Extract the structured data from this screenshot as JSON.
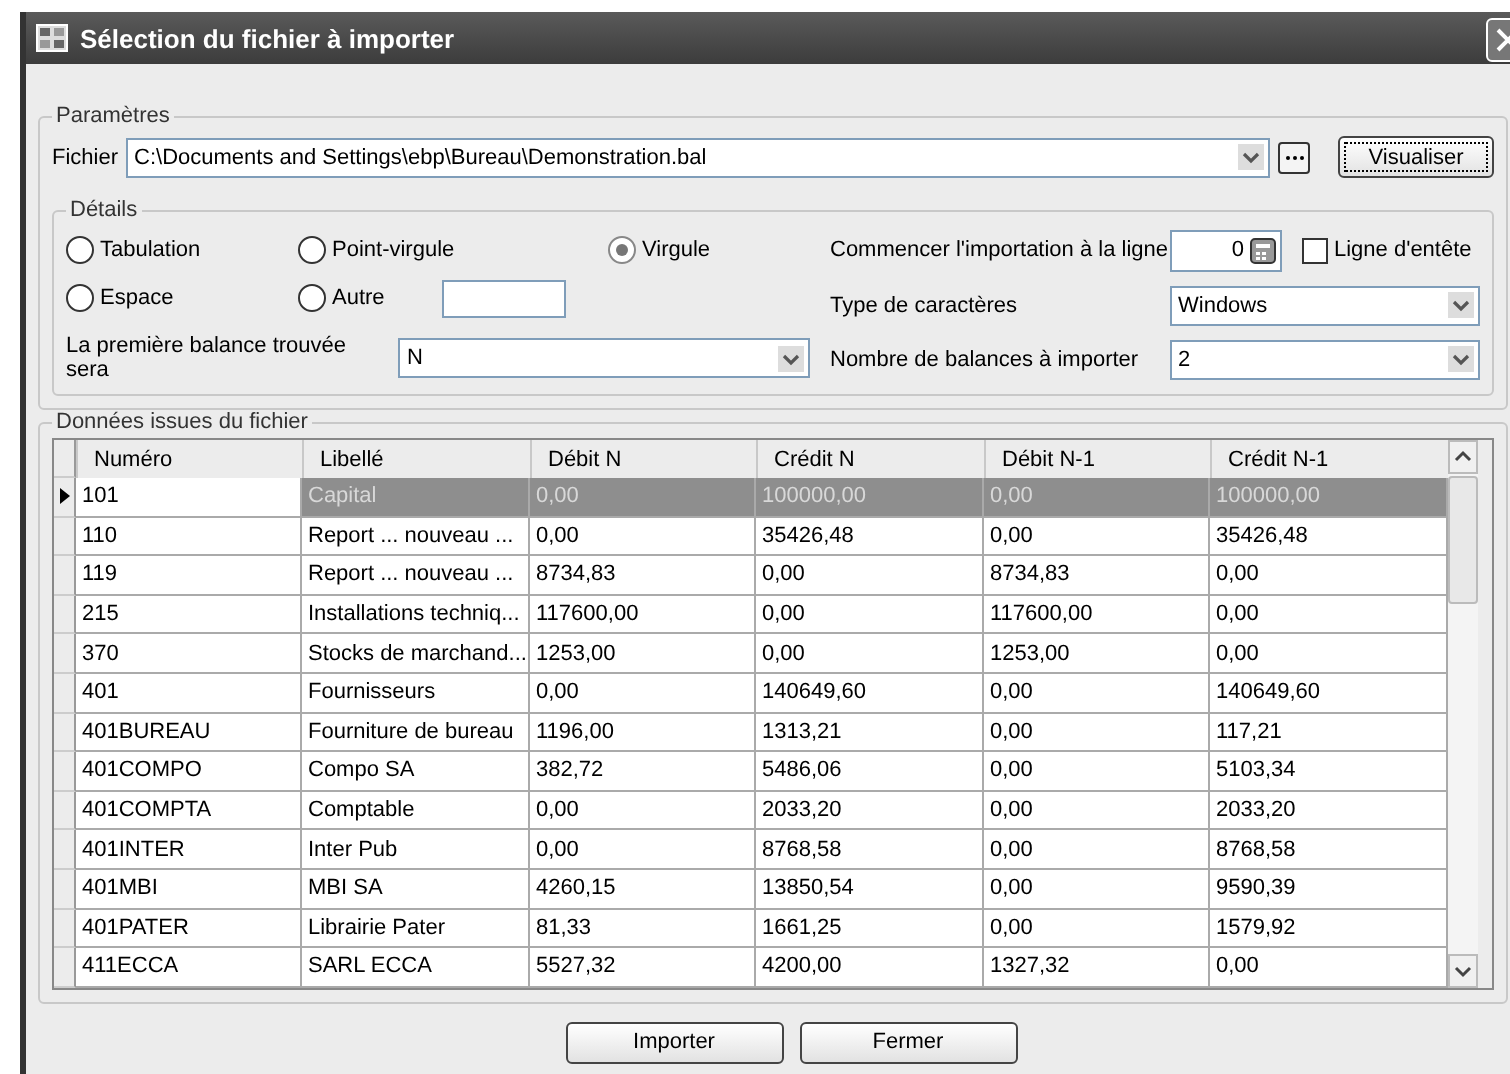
{
  "window": {
    "title": "Sélection du fichier à importer"
  },
  "parametres": {
    "legend": "Paramètres",
    "file_label": "Fichier",
    "file_value": "C:\\Documents and Settings\\ebp\\Bureau\\Demonstration.bal",
    "preview_button": "Visualiser"
  },
  "details": {
    "legend": "Détails",
    "separators": [
      {
        "label": "Tabulation",
        "selected": false
      },
      {
        "label": "Point-virgule",
        "selected": false
      },
      {
        "label": "Virgule",
        "selected": true
      },
      {
        "label": "Espace",
        "selected": false
      },
      {
        "label": "Autre",
        "selected": false
      }
    ],
    "first_balance_label": "La première balance trouvée sera",
    "first_balance_value": "N",
    "start_line_label": "Commencer l'importation à la ligne",
    "start_line_value": "0",
    "header_line": {
      "label": "Ligne d'entête",
      "checked": false
    },
    "charset_label": "Type de caractères",
    "charset_value": "Windows",
    "count_label": "Nombre de balances à importer",
    "count_value": "2"
  },
  "data": {
    "legend": "Données issues du fichier",
    "columns": [
      "Numéro",
      "Libellé",
      "Débit N",
      "Crédit N",
      "Débit N-1",
      "Crédit N-1"
    ],
    "rows": [
      {
        "selected": true,
        "cells": [
          "101",
          "Capital",
          "0,00",
          "100000,00",
          "0,00",
          "100000,00"
        ]
      },
      {
        "selected": false,
        "cells": [
          "110",
          "Report ... nouveau ...",
          "0,00",
          "35426,48",
          "0,00",
          "35426,48"
        ]
      },
      {
        "selected": false,
        "cells": [
          "119",
          "Report ... nouveau ...",
          "8734,83",
          "0,00",
          "8734,83",
          "0,00"
        ]
      },
      {
        "selected": false,
        "cells": [
          "215",
          "Installations techniq...",
          "117600,00",
          "0,00",
          "117600,00",
          "0,00"
        ]
      },
      {
        "selected": false,
        "cells": [
          "370",
          "Stocks de marchand...",
          "1253,00",
          "0,00",
          "1253,00",
          "0,00"
        ]
      },
      {
        "selected": false,
        "cells": [
          "401",
          "Fournisseurs",
          "0,00",
          "140649,60",
          "0,00",
          "140649,60"
        ]
      },
      {
        "selected": false,
        "cells": [
          "401BUREAU",
          "Fourniture de bureau",
          "1196,00",
          "1313,21",
          "0,00",
          "117,21"
        ]
      },
      {
        "selected": false,
        "cells": [
          "401COMPO",
          "Compo SA",
          "382,72",
          "5486,06",
          "0,00",
          "5103,34"
        ]
      },
      {
        "selected": false,
        "cells": [
          "401COMPTA",
          "Comptable",
          "0,00",
          "2033,20",
          "0,00",
          "2033,20"
        ]
      },
      {
        "selected": false,
        "cells": [
          "401INTER",
          "Inter Pub",
          "0,00",
          "8768,58",
          "0,00",
          "8768,58"
        ]
      },
      {
        "selected": false,
        "cells": [
          "401MBI",
          "MBI SA",
          "4260,15",
          "13850,54",
          "0,00",
          "9590,39"
        ]
      },
      {
        "selected": false,
        "cells": [
          "401PATER",
          "Librairie Pater",
          "81,33",
          "1661,25",
          "0,00",
          "1579,92"
        ]
      },
      {
        "selected": false,
        "cells": [
          "411ECCA",
          "SARL ECCA",
          "5527,32",
          "4200,00",
          "1327,32",
          "0,00"
        ]
      }
    ]
  },
  "buttons": [
    "Importer",
    "Fermer"
  ]
}
